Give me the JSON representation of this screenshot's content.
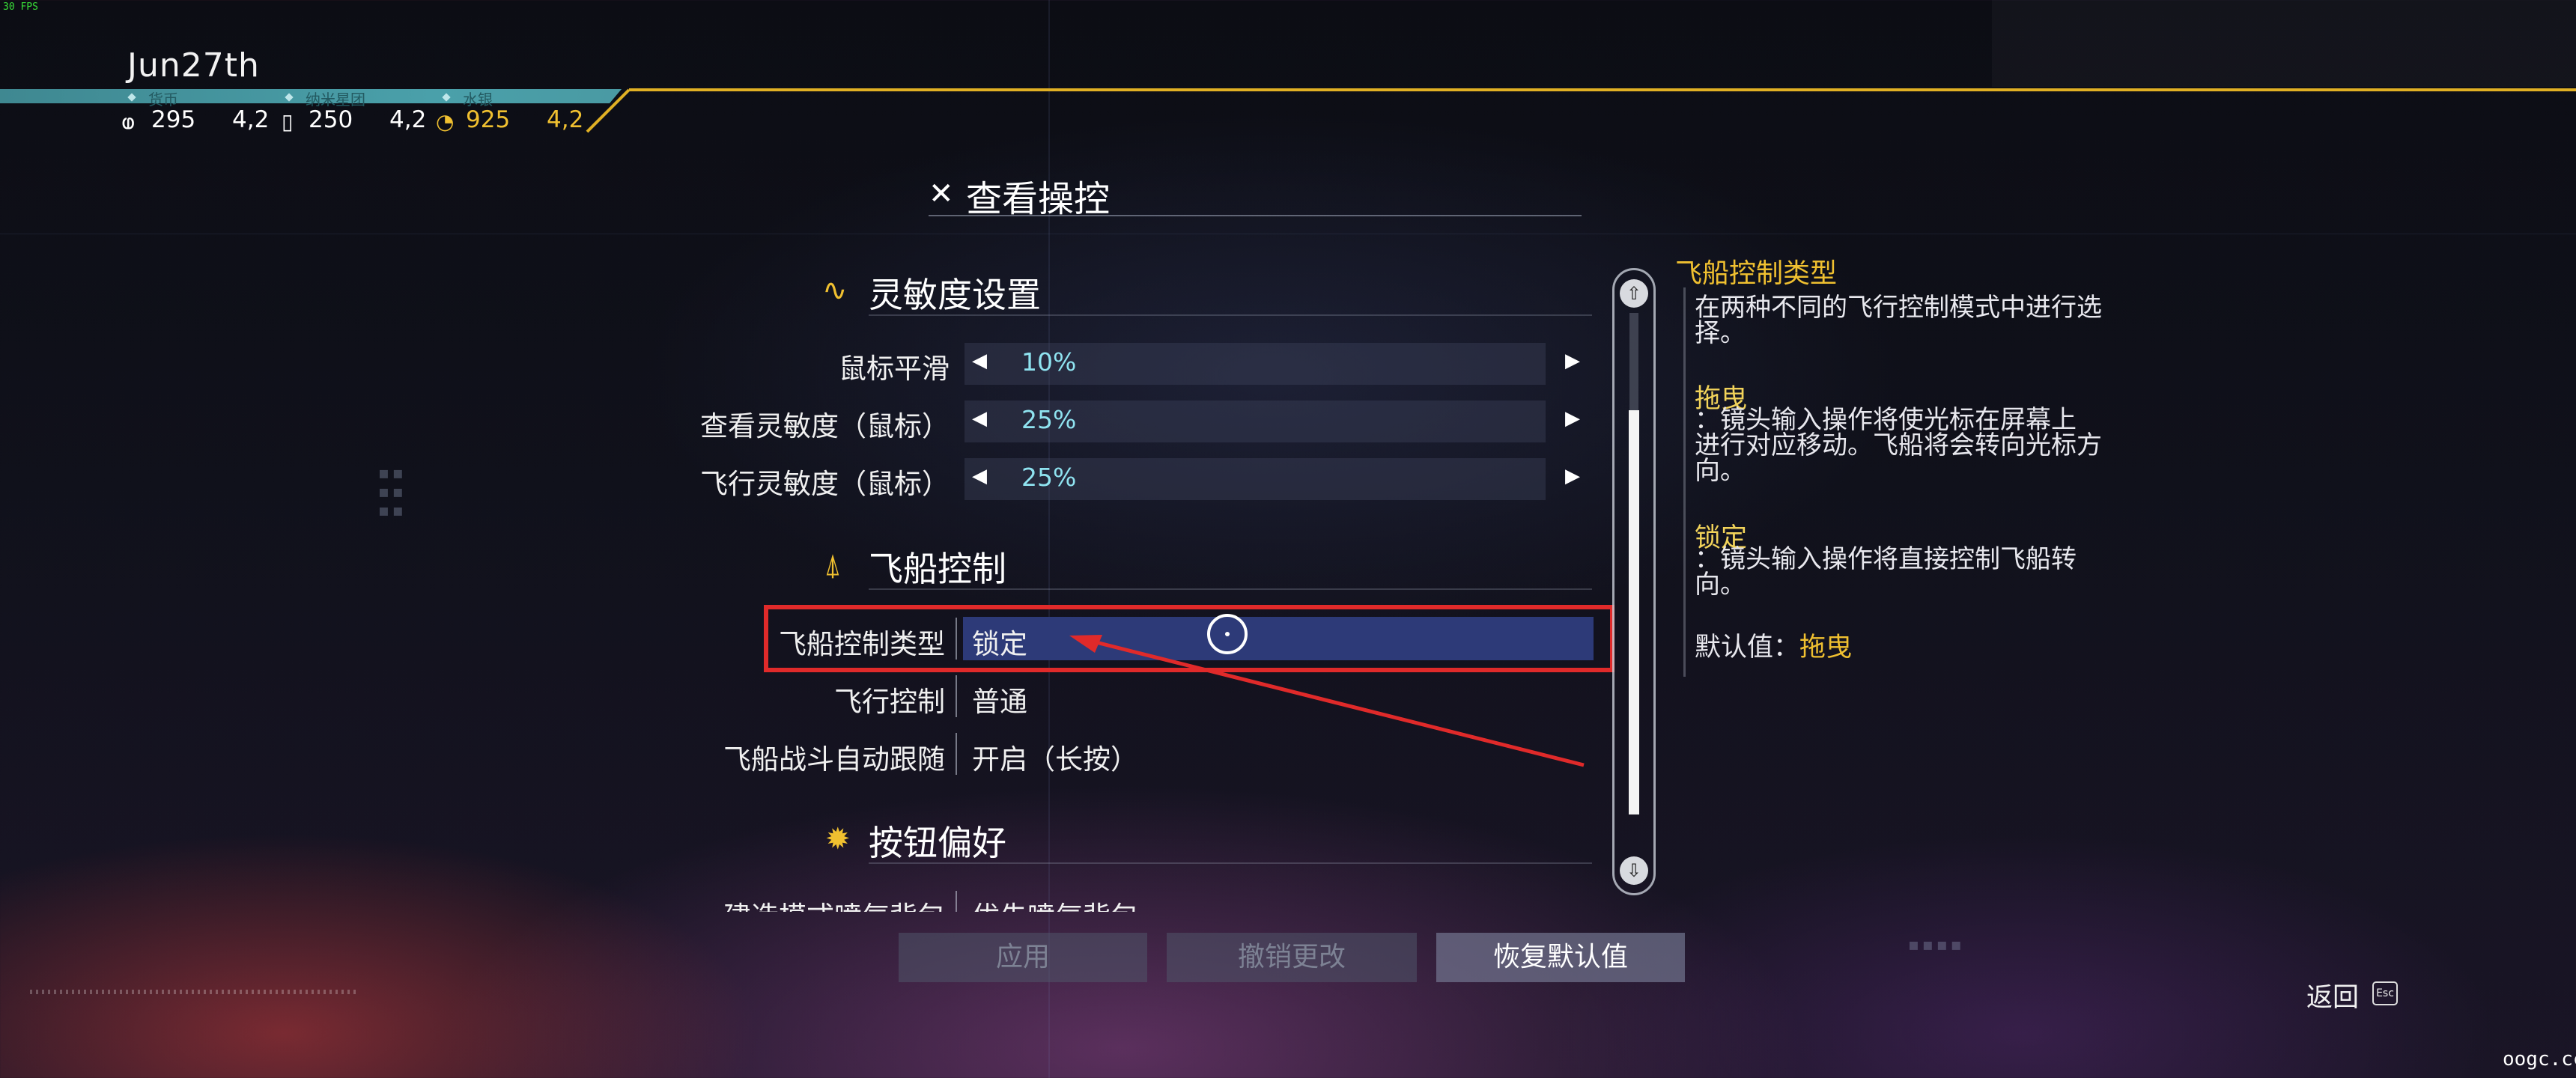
{
  "fps": "30 FPS",
  "date": "Jun27th",
  "resources": [
    {
      "label": "货币",
      "icon": "currency-icon",
      "glyph": "ⱷ",
      "value": "295",
      "tail": "4,2"
    },
    {
      "label": "纳米星团",
      "icon": "nanocluster-icon",
      "glyph": "▯",
      "value": "250",
      "tail": "4,2"
    },
    {
      "label": "水银",
      "icon": "quicksilver-icon",
      "glyph": "◔",
      "value": "925",
      "tail": "4,2"
    }
  ],
  "title": "查看操控",
  "sections": {
    "sensitivity": {
      "heading": "灵敏度设置",
      "rows": [
        {
          "label": "鼠标平滑",
          "value": "10%"
        },
        {
          "label": "查看灵敏度（鼠标）",
          "value": "25%"
        },
        {
          "label": "飞行灵敏度（鼠标）",
          "value": "25%"
        }
      ]
    },
    "ship": {
      "heading": "飞船控制",
      "rows": [
        {
          "label": "飞船控制类型",
          "value": "锁定"
        },
        {
          "label": "飞行控制",
          "value": "普通"
        },
        {
          "label": "飞船战斗自动跟随",
          "value": "开启（长按）"
        }
      ]
    },
    "buttons": {
      "heading": "按钮偏好",
      "rows": [
        {
          "label": "建造模式喷气背包",
          "value": "优先喷气背包"
        }
      ]
    }
  },
  "description": {
    "title": "飞船控制类型",
    "intro_line1": "在两种不同的飞行控制模式中进行选",
    "intro_line2": "择。",
    "option1_name": "拖曳",
    "option1_line1": "：镜头输入操作将使光标在屏幕上",
    "option1_line2": "进行对应移动。飞船将会转向光标方",
    "option1_line3": "向。",
    "option2_name": "锁定",
    "option2_line1": "：镜头输入操作将直接控制飞船转",
    "option2_line2": "向。",
    "default_label": "默认值：",
    "default_value": "拖曳"
  },
  "footer": {
    "apply": "应用",
    "revert": "撤销更改",
    "restore": "恢复默认值"
  },
  "back": {
    "label": "返回",
    "key": "Esc"
  },
  "watermark": "oogc.cc",
  "colors": {
    "accent_gold": "#e0b024",
    "teal": "#4aa0aa",
    "highlight_red": "#e02a2a",
    "selection": "#2d3a78"
  }
}
